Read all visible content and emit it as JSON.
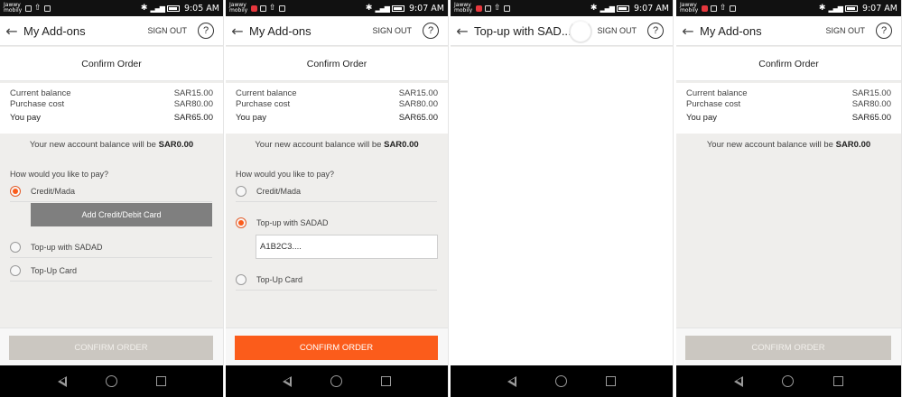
{
  "screens": [
    {
      "status": {
        "carrier": "Jawwy mobily",
        "time": "9:05 AM"
      },
      "title": "My Add-ons",
      "sign_out": "SIGN OUT",
      "help": "?",
      "section_title": "Confirm Order",
      "summary": {
        "current_balance_label": "Current balance",
        "current_balance": "SAR15.00",
        "purchase_cost_label": "Purchase cost",
        "purchase_cost": "SAR80.00",
        "you_pay_label": "You pay",
        "you_pay": "SAR65.00"
      },
      "new_balance_text": "Your new account balance will be",
      "new_balance_value": "SAR0.00",
      "pay_question": "How would you like to pay?",
      "options": [
        "Credit/Mada",
        "Top-up with SADAD",
        "Top-Up Card"
      ],
      "selected": "Credit/Mada",
      "add_card_label": "Add Credit/Debit Card",
      "confirm_label": "CONFIRM ORDER",
      "confirm_state": "disabled"
    },
    {
      "status": {
        "carrier": "Jawwy mobily",
        "time": "9:07 AM"
      },
      "title": "My Add-ons",
      "sign_out": "SIGN OUT",
      "help": "?",
      "section_title": "Confirm Order",
      "summary": {
        "current_balance_label": "Current balance",
        "current_balance": "SAR15.00",
        "purchase_cost_label": "Purchase cost",
        "purchase_cost": "SAR80.00",
        "you_pay_label": "You pay",
        "you_pay": "SAR65.00"
      },
      "new_balance_text": "Your new account balance will be",
      "new_balance_value": "SAR0.00",
      "pay_question": "How would you like to pay?",
      "options": [
        "Credit/Mada",
        "Top-up with SADAD",
        "Top-Up Card"
      ],
      "selected": "Top-up with SADAD",
      "sadad_code": "A1B2C3....",
      "confirm_label": "CONFIRM ORDER",
      "confirm_state": "active"
    },
    {
      "status": {
        "carrier": "Jawwy mobily",
        "time": "9:07 AM"
      },
      "title": "Top-up with SAD...",
      "sign_out": "SIGN OUT",
      "help": "?",
      "loading": true
    },
    {
      "status": {
        "carrier": "Jawwy mobily",
        "time": "9:07 AM"
      },
      "title": "My Add-ons",
      "sign_out": "SIGN OUT",
      "help": "?",
      "section_title": "Confirm Order",
      "summary": {
        "current_balance_label": "Current balance",
        "current_balance": "SAR15.00",
        "purchase_cost_label": "Purchase cost",
        "purchase_cost": "SAR80.00",
        "you_pay_label": "You pay",
        "you_pay": "SAR65.00"
      },
      "new_balance_text": "Your new account balance will be",
      "new_balance_value": "SAR0.00",
      "confirm_label": "CONFIRM ORDER",
      "confirm_state": "disabled"
    }
  ],
  "colors": {
    "accent": "#fb5c1b",
    "disabled": "#cbc7c1",
    "add_card": "#7f7f7f",
    "background": "#efeeec"
  }
}
